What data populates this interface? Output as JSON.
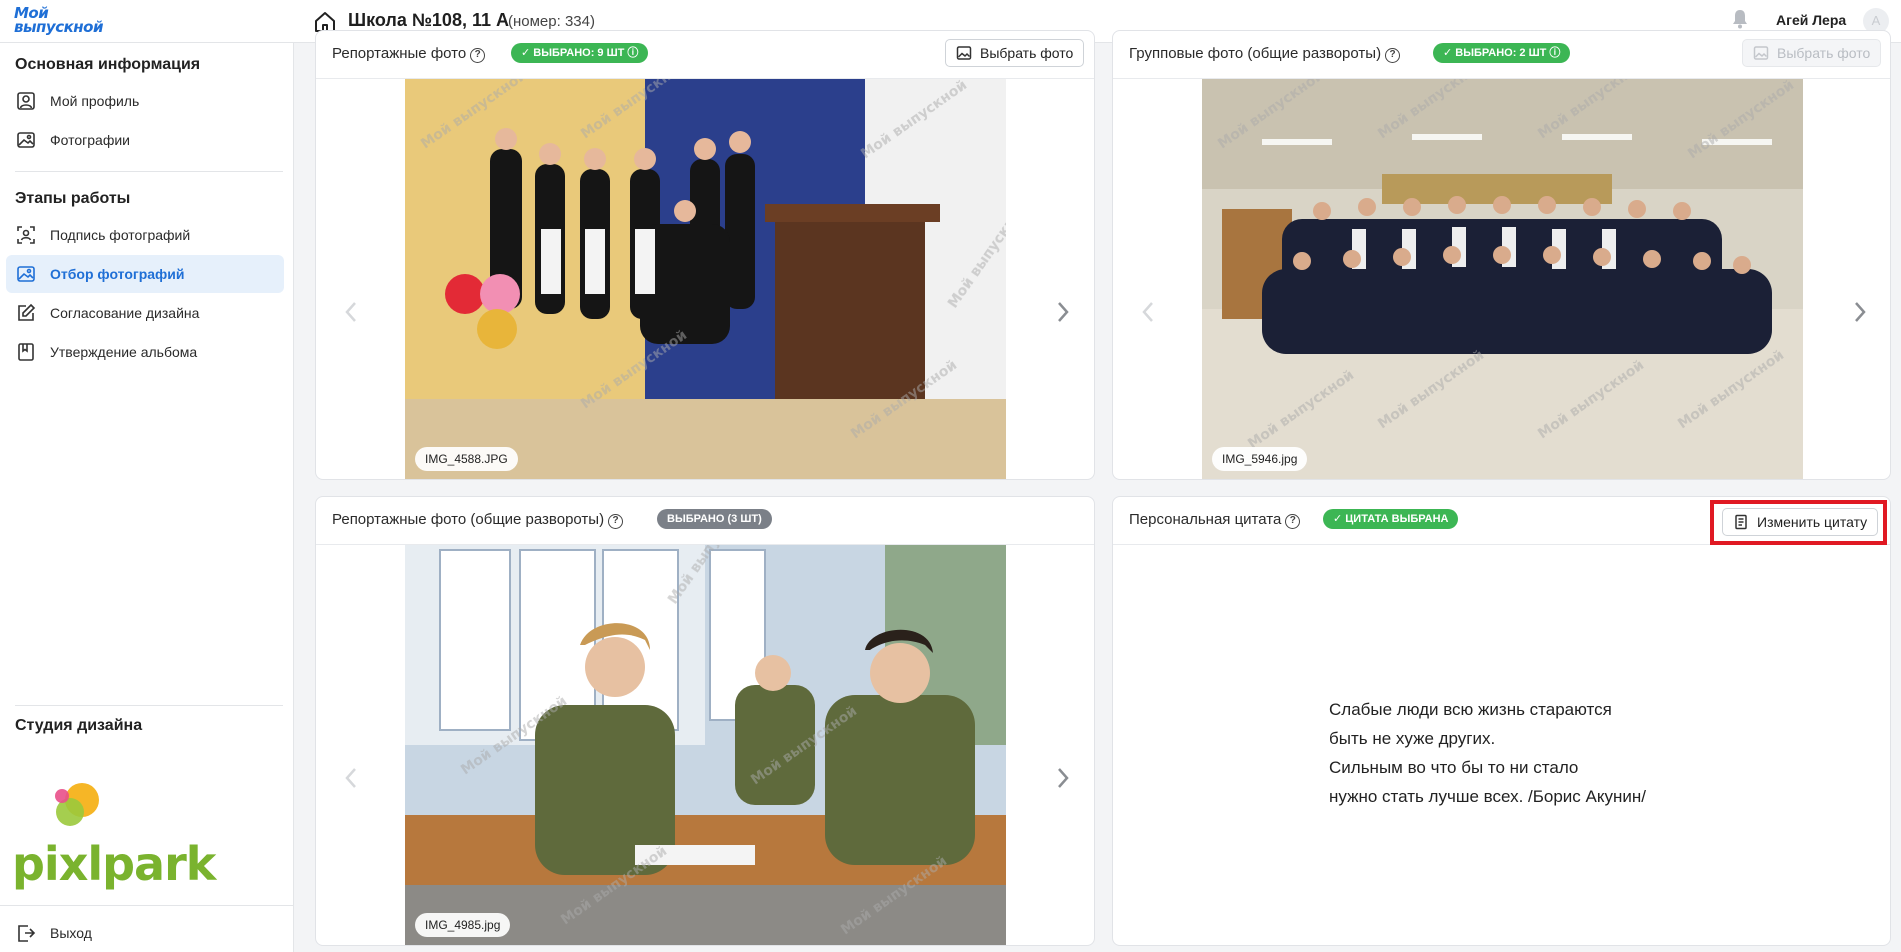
{
  "app": {
    "logo_line1": "Мой",
    "logo_line2": "выпускной"
  },
  "header": {
    "school_title": "Школа №108, 11 А",
    "school_number": "(номер: 334)",
    "user_name": "Агей Лера",
    "avatar_letter": "А"
  },
  "sidebar": {
    "section_main": "Основная информация",
    "main_items": [
      {
        "label": "Мой профиль",
        "icon": "user-icon"
      },
      {
        "label": "Фотографии",
        "icon": "image-icon"
      }
    ],
    "section_stages": "Этапы работы",
    "stage_items": [
      {
        "label": "Подпись фотографий",
        "icon": "face-scan-icon"
      },
      {
        "label": "Отбор фотографий",
        "icon": "gallery-icon",
        "active": true
      },
      {
        "label": "Согласование дизайна",
        "icon": "edit-icon"
      },
      {
        "label": "Утверждение альбома",
        "icon": "book-icon"
      }
    ],
    "section_studio": "Студия дизайна",
    "studio_logo": "pixlpark",
    "logout_label": "Выход"
  },
  "cards": {
    "reportage": {
      "title": "Репортажные фото",
      "badge": "✓ ВЫБРАНО: 9 ШТ ⓘ",
      "button": "Выбрать фото",
      "filename": "IMG_4588.JPG"
    },
    "group": {
      "title": "Групповые фото (общие развороты)",
      "badge": "✓ ВЫБРАНО: 2 ШТ ⓘ",
      "button": "Выбрать фото",
      "filename": "IMG_5946.jpg"
    },
    "reportage_spreads": {
      "title": "Репортажные фото (общие развороты)",
      "badge": "ВЫБРАНО (3 ШТ)",
      "filename": "IMG_4985.jpg"
    },
    "quote": {
      "title": "Персональная цитата",
      "badge": "✓ ЦИТАТА ВЫБРАНА",
      "button": "Изменить цитату",
      "lines": [
        "Слабые люди всю жизнь стараются",
        "быть не хуже других.",
        "Сильным во что бы то ни стало",
        "нужно стать лучше всех. /Борис Акунин/"
      ]
    }
  },
  "watermark": "Мой выпускной",
  "colors": {
    "accent": "#1f6fd6",
    "badge_green": "#3cb654",
    "badge_gray": "#7b8088",
    "highlight_red": "#e01923",
    "brand_green": "#7ab32e"
  }
}
